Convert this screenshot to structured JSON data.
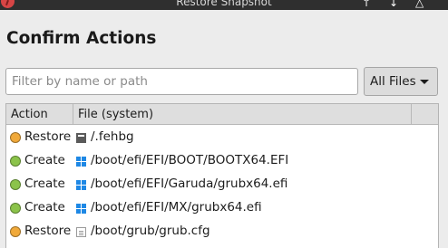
{
  "window": {
    "title": "Restore Snapshot"
  },
  "heading": "Confirm Actions",
  "filter": {
    "placeholder": "Filter by name or path",
    "value": ""
  },
  "file_filter": {
    "selected": "All Files"
  },
  "table": {
    "columns": [
      "Action",
      "File (system)",
      ""
    ],
    "rows": [
      {
        "action": "Restore",
        "status_color": "#f0a93a",
        "icon": "shell-script-icon",
        "path": "/.fehbg"
      },
      {
        "action": "Create",
        "status_color": "#8bc34a",
        "icon": "efi-binary-icon",
        "path": "/boot/efi/EFI/BOOT/BOOTX64.EFI"
      },
      {
        "action": "Create",
        "status_color": "#8bc34a",
        "icon": "efi-binary-icon",
        "path": "/boot/efi/EFI/Garuda/grubx64.efi"
      },
      {
        "action": "Create",
        "status_color": "#8bc34a",
        "icon": "efi-binary-icon",
        "path": "/boot/efi/EFI/MX/grubx64.efi"
      },
      {
        "action": "Restore",
        "status_color": "#f0a93a",
        "icon": "text-file-icon",
        "path": "/boot/grub/grub.cfg"
      }
    ]
  },
  "colors": {
    "restore": "#f0a93a",
    "create": "#8bc34a",
    "windows_logo": "#1e88e5",
    "titlebar": "#2f2f2f"
  }
}
